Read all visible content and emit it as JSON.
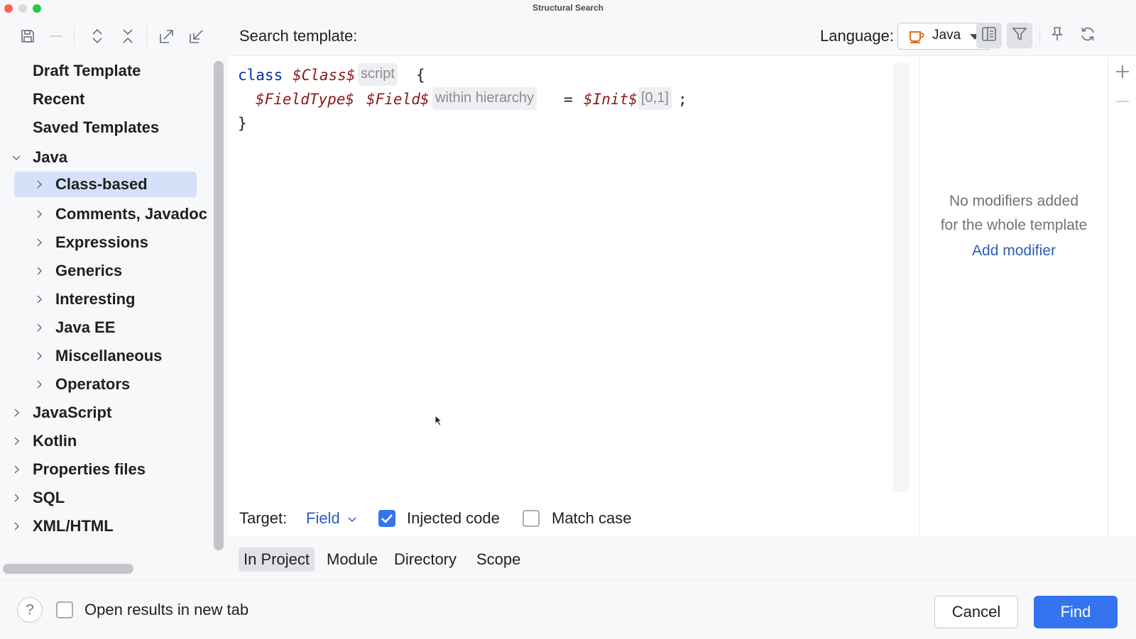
{
  "window": {
    "title": "Structural Search"
  },
  "toolbar": {
    "icons": [
      "save-icon",
      "minus-icon",
      "expand-all-icon",
      "collapse-all-icon",
      "export-icon",
      "import-icon"
    ]
  },
  "tree": {
    "items": [
      {
        "label": "Draft Template",
        "level": 0,
        "chevron": "none"
      },
      {
        "label": "Recent",
        "level": 0,
        "chevron": "none"
      },
      {
        "label": "Saved Templates",
        "level": 0,
        "chevron": "none"
      },
      {
        "label": "Java",
        "level": 0,
        "chevron": "down"
      },
      {
        "label": "Class-based",
        "level": 1,
        "chevron": "right",
        "selected": true
      },
      {
        "label": "Comments, Javadoc",
        "level": 1,
        "chevron": "right"
      },
      {
        "label": "Expressions",
        "level": 1,
        "chevron": "right"
      },
      {
        "label": "Generics",
        "level": 1,
        "chevron": "right"
      },
      {
        "label": "Interesting",
        "level": 1,
        "chevron": "right"
      },
      {
        "label": "Java EE",
        "level": 1,
        "chevron": "right"
      },
      {
        "label": "Miscellaneous",
        "level": 1,
        "chevron": "right"
      },
      {
        "label": "Operators",
        "level": 1,
        "chevron": "right"
      },
      {
        "label": "JavaScript",
        "level": 0,
        "chevron": "right"
      },
      {
        "label": "Kotlin",
        "level": 0,
        "chevron": "right"
      },
      {
        "label": "Properties files",
        "level": 0,
        "chevron": "right"
      },
      {
        "label": "SQL",
        "level": 0,
        "chevron": "right"
      },
      {
        "label": "XML/HTML",
        "level": 0,
        "chevron": "right"
      }
    ]
  },
  "header": {
    "search_template_label": "Search template:",
    "language_label": "Language:",
    "language_value": "Java"
  },
  "editor": {
    "line1": {
      "keyword": "class",
      "var": "$Class$",
      "inlay": "script",
      "brace": "{"
    },
    "line2": {
      "type_var": "$FieldType$",
      "field_var": "$Field$",
      "field_inlay": "within hierarchy",
      "eq": "=",
      "init_var": "$Init$",
      "init_inlay": "[0,1]",
      "semi": ";"
    },
    "line3": {
      "brace": "}"
    }
  },
  "target": {
    "label": "Target:",
    "value": "Field",
    "injected_code": {
      "label": "Injected code",
      "checked": true
    },
    "match_case": {
      "label": "Match case",
      "checked": false
    }
  },
  "modifiers": {
    "empty_line1": "No modifiers added",
    "empty_line2": "for the whole template",
    "add_link": "Add modifier"
  },
  "scope": {
    "tabs": [
      {
        "label": "In Project",
        "active": true
      },
      {
        "label": "Module",
        "active": false
      },
      {
        "label": "Directory",
        "active": false
      },
      {
        "label": "Scope",
        "active": false
      }
    ]
  },
  "footer": {
    "help": "?",
    "open_new_tab": {
      "label": "Open results in new tab",
      "checked": false
    },
    "cancel": "Cancel",
    "find": "Find"
  },
  "colors": {
    "accent": "#3574f0",
    "selection": "#d5e1f9",
    "link": "#2e5bb8",
    "template_var": "#871094",
    "keyword": "#0033b3"
  }
}
